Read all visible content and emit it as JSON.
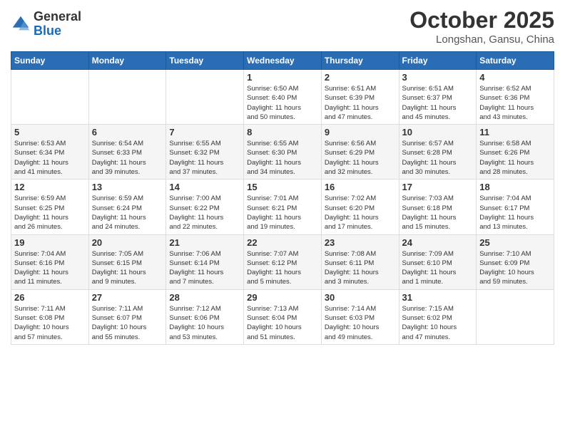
{
  "logo": {
    "general": "General",
    "blue": "Blue"
  },
  "header": {
    "month": "October 2025",
    "location": "Longshan, Gansu, China"
  },
  "weekdays": [
    "Sunday",
    "Monday",
    "Tuesday",
    "Wednesday",
    "Thursday",
    "Friday",
    "Saturday"
  ],
  "weeks": [
    [
      {
        "day": "",
        "info": ""
      },
      {
        "day": "",
        "info": ""
      },
      {
        "day": "",
        "info": ""
      },
      {
        "day": "1",
        "info": "Sunrise: 6:50 AM\nSunset: 6:40 PM\nDaylight: 11 hours\nand 50 minutes."
      },
      {
        "day": "2",
        "info": "Sunrise: 6:51 AM\nSunset: 6:39 PM\nDaylight: 11 hours\nand 47 minutes."
      },
      {
        "day": "3",
        "info": "Sunrise: 6:51 AM\nSunset: 6:37 PM\nDaylight: 11 hours\nand 45 minutes."
      },
      {
        "day": "4",
        "info": "Sunrise: 6:52 AM\nSunset: 6:36 PM\nDaylight: 11 hours\nand 43 minutes."
      }
    ],
    [
      {
        "day": "5",
        "info": "Sunrise: 6:53 AM\nSunset: 6:34 PM\nDaylight: 11 hours\nand 41 minutes."
      },
      {
        "day": "6",
        "info": "Sunrise: 6:54 AM\nSunset: 6:33 PM\nDaylight: 11 hours\nand 39 minutes."
      },
      {
        "day": "7",
        "info": "Sunrise: 6:55 AM\nSunset: 6:32 PM\nDaylight: 11 hours\nand 37 minutes."
      },
      {
        "day": "8",
        "info": "Sunrise: 6:55 AM\nSunset: 6:30 PM\nDaylight: 11 hours\nand 34 minutes."
      },
      {
        "day": "9",
        "info": "Sunrise: 6:56 AM\nSunset: 6:29 PM\nDaylight: 11 hours\nand 32 minutes."
      },
      {
        "day": "10",
        "info": "Sunrise: 6:57 AM\nSunset: 6:28 PM\nDaylight: 11 hours\nand 30 minutes."
      },
      {
        "day": "11",
        "info": "Sunrise: 6:58 AM\nSunset: 6:26 PM\nDaylight: 11 hours\nand 28 minutes."
      }
    ],
    [
      {
        "day": "12",
        "info": "Sunrise: 6:59 AM\nSunset: 6:25 PM\nDaylight: 11 hours\nand 26 minutes."
      },
      {
        "day": "13",
        "info": "Sunrise: 6:59 AM\nSunset: 6:24 PM\nDaylight: 11 hours\nand 24 minutes."
      },
      {
        "day": "14",
        "info": "Sunrise: 7:00 AM\nSunset: 6:22 PM\nDaylight: 11 hours\nand 22 minutes."
      },
      {
        "day": "15",
        "info": "Sunrise: 7:01 AM\nSunset: 6:21 PM\nDaylight: 11 hours\nand 19 minutes."
      },
      {
        "day": "16",
        "info": "Sunrise: 7:02 AM\nSunset: 6:20 PM\nDaylight: 11 hours\nand 17 minutes."
      },
      {
        "day": "17",
        "info": "Sunrise: 7:03 AM\nSunset: 6:18 PM\nDaylight: 11 hours\nand 15 minutes."
      },
      {
        "day": "18",
        "info": "Sunrise: 7:04 AM\nSunset: 6:17 PM\nDaylight: 11 hours\nand 13 minutes."
      }
    ],
    [
      {
        "day": "19",
        "info": "Sunrise: 7:04 AM\nSunset: 6:16 PM\nDaylight: 11 hours\nand 11 minutes."
      },
      {
        "day": "20",
        "info": "Sunrise: 7:05 AM\nSunset: 6:15 PM\nDaylight: 11 hours\nand 9 minutes."
      },
      {
        "day": "21",
        "info": "Sunrise: 7:06 AM\nSunset: 6:14 PM\nDaylight: 11 hours\nand 7 minutes."
      },
      {
        "day": "22",
        "info": "Sunrise: 7:07 AM\nSunset: 6:12 PM\nDaylight: 11 hours\nand 5 minutes."
      },
      {
        "day": "23",
        "info": "Sunrise: 7:08 AM\nSunset: 6:11 PM\nDaylight: 11 hours\nand 3 minutes."
      },
      {
        "day": "24",
        "info": "Sunrise: 7:09 AM\nSunset: 6:10 PM\nDaylight: 11 hours\nand 1 minute."
      },
      {
        "day": "25",
        "info": "Sunrise: 7:10 AM\nSunset: 6:09 PM\nDaylight: 10 hours\nand 59 minutes."
      }
    ],
    [
      {
        "day": "26",
        "info": "Sunrise: 7:11 AM\nSunset: 6:08 PM\nDaylight: 10 hours\nand 57 minutes."
      },
      {
        "day": "27",
        "info": "Sunrise: 7:11 AM\nSunset: 6:07 PM\nDaylight: 10 hours\nand 55 minutes."
      },
      {
        "day": "28",
        "info": "Sunrise: 7:12 AM\nSunset: 6:06 PM\nDaylight: 10 hours\nand 53 minutes."
      },
      {
        "day": "29",
        "info": "Sunrise: 7:13 AM\nSunset: 6:04 PM\nDaylight: 10 hours\nand 51 minutes."
      },
      {
        "day": "30",
        "info": "Sunrise: 7:14 AM\nSunset: 6:03 PM\nDaylight: 10 hours\nand 49 minutes."
      },
      {
        "day": "31",
        "info": "Sunrise: 7:15 AM\nSunset: 6:02 PM\nDaylight: 10 hours\nand 47 minutes."
      },
      {
        "day": "",
        "info": ""
      }
    ]
  ]
}
